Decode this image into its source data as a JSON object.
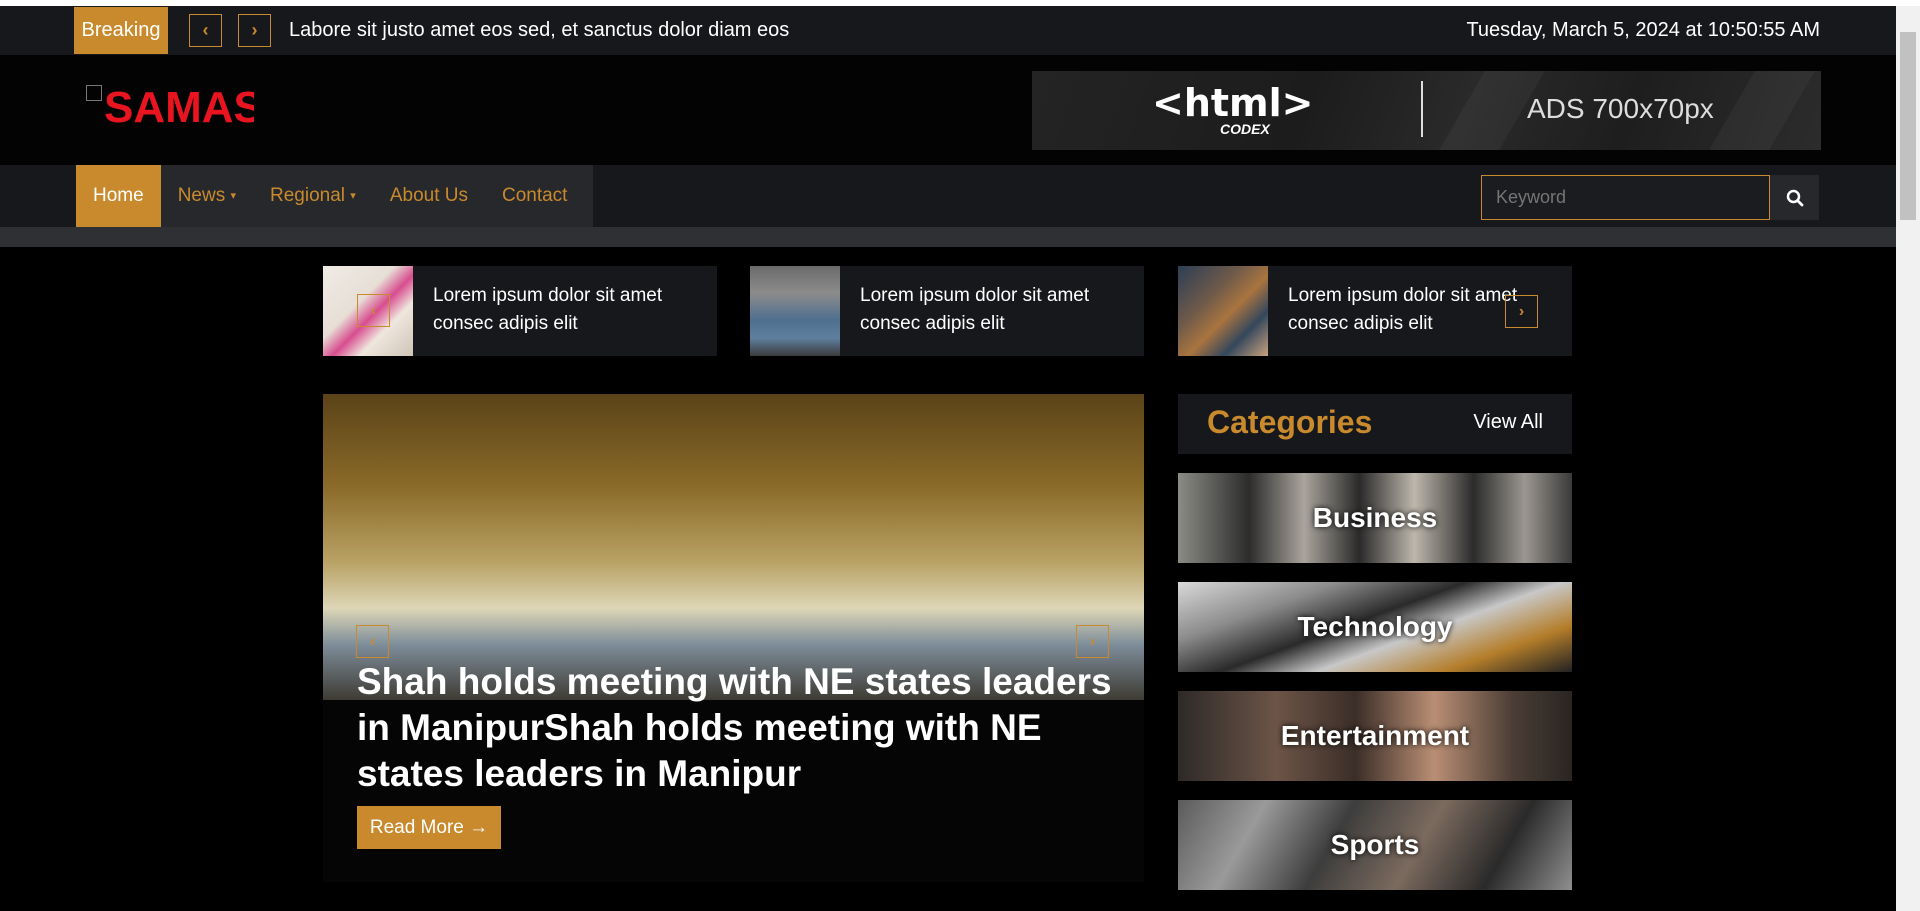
{
  "topbar": {
    "breaking_label": "Breaking",
    "ticker_text": "Labore sit justo amet eos sed, et sanctus dolor diam eos",
    "datetime": "Tuesday, March 5, 2024 at 10:50:55 AM"
  },
  "header": {
    "logo_text": "SAMAS",
    "ad_brand": "<html>",
    "ad_brand_sub": "CODEX",
    "ad_text": "ADS 700x70px"
  },
  "nav": {
    "items": [
      {
        "label": "Home",
        "active": true
      },
      {
        "label": "News",
        "dropdown": true
      },
      {
        "label": "Regional",
        "dropdown": true
      },
      {
        "label": "About Us"
      },
      {
        "label": "Contact"
      }
    ],
    "search_placeholder": "Keyword"
  },
  "top_cards": [
    {
      "text": "Lorem ipsum dolor sit amet consec adipis elit"
    },
    {
      "text": "Lorem ipsum dolor sit amet consec adipis elit"
    },
    {
      "text": "Lorem ipsum dolor sit amet consec adipis elit"
    }
  ],
  "hero": {
    "title": "Shah holds meeting with NE states leaders in ManipurShah holds meeting with NE states leaders in Manipur",
    "read_more": "Read More →"
  },
  "categories": {
    "title": "Categories",
    "view_all": "View All",
    "items": [
      {
        "label": "Business"
      },
      {
        "label": "Technology"
      },
      {
        "label": "Entertainment"
      },
      {
        "label": "Sports"
      }
    ]
  },
  "colors": {
    "accent": "#c88a2c",
    "logo_red": "#e8141f",
    "bar_dark": "#16181b"
  }
}
